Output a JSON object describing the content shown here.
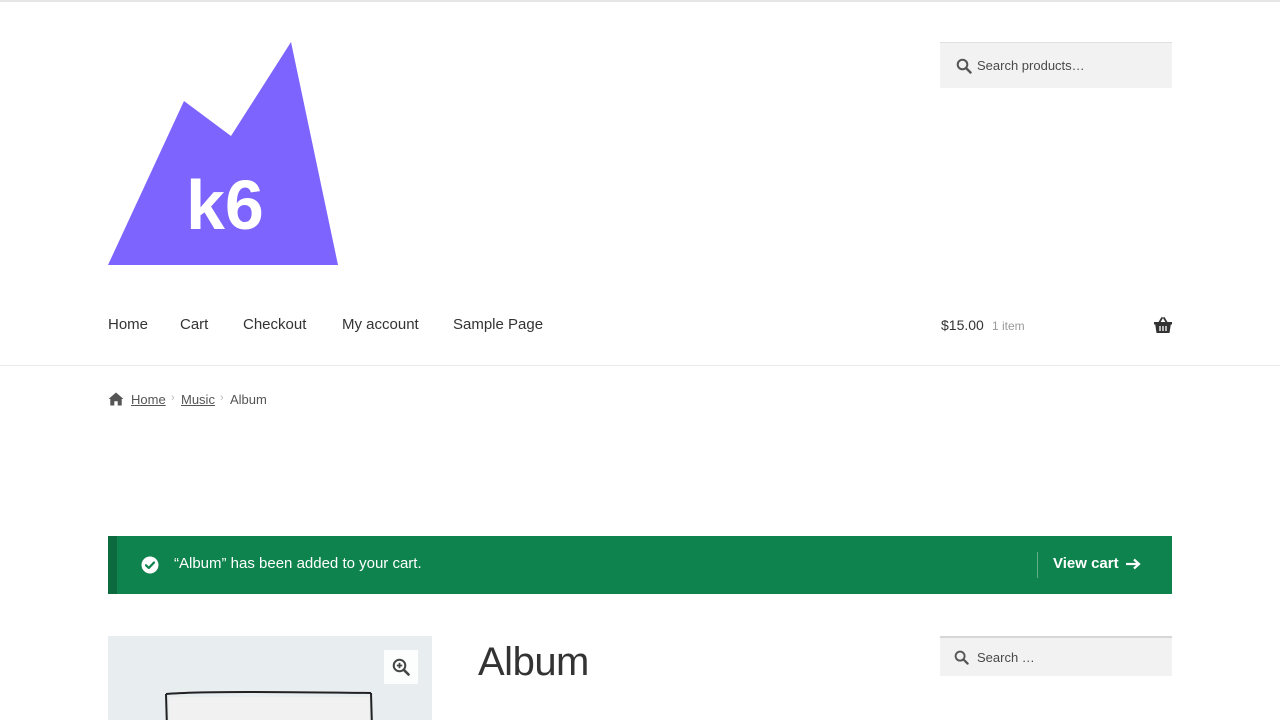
{
  "site": {
    "logo_text": "k6",
    "brand_color": "#7d64ff"
  },
  "header": {
    "search": {
      "placeholder": "Search products…",
      "icon": "search-icon"
    },
    "nav": [
      {
        "label": "Home"
      },
      {
        "label": "Cart"
      },
      {
        "label": "Checkout"
      },
      {
        "label": "My account"
      },
      {
        "label": "Sample Page"
      }
    ],
    "cart": {
      "amount": "$15.00",
      "count": "1 item",
      "icon": "basket-icon"
    }
  },
  "breadcrumb": {
    "icon": "home-icon",
    "items": [
      {
        "label": "Home"
      },
      {
        "label": "Music"
      },
      {
        "label": "Album"
      }
    ]
  },
  "notice": {
    "message": "“Album” has been added to your cart.",
    "action_label": "View cart",
    "color": "#0f834d",
    "icon": "check-circle-icon"
  },
  "product": {
    "title": "Album",
    "zoom_icon": "zoom-in-icon"
  },
  "sidebar": {
    "search": {
      "placeholder": "Search …",
      "icon": "search-icon"
    }
  }
}
